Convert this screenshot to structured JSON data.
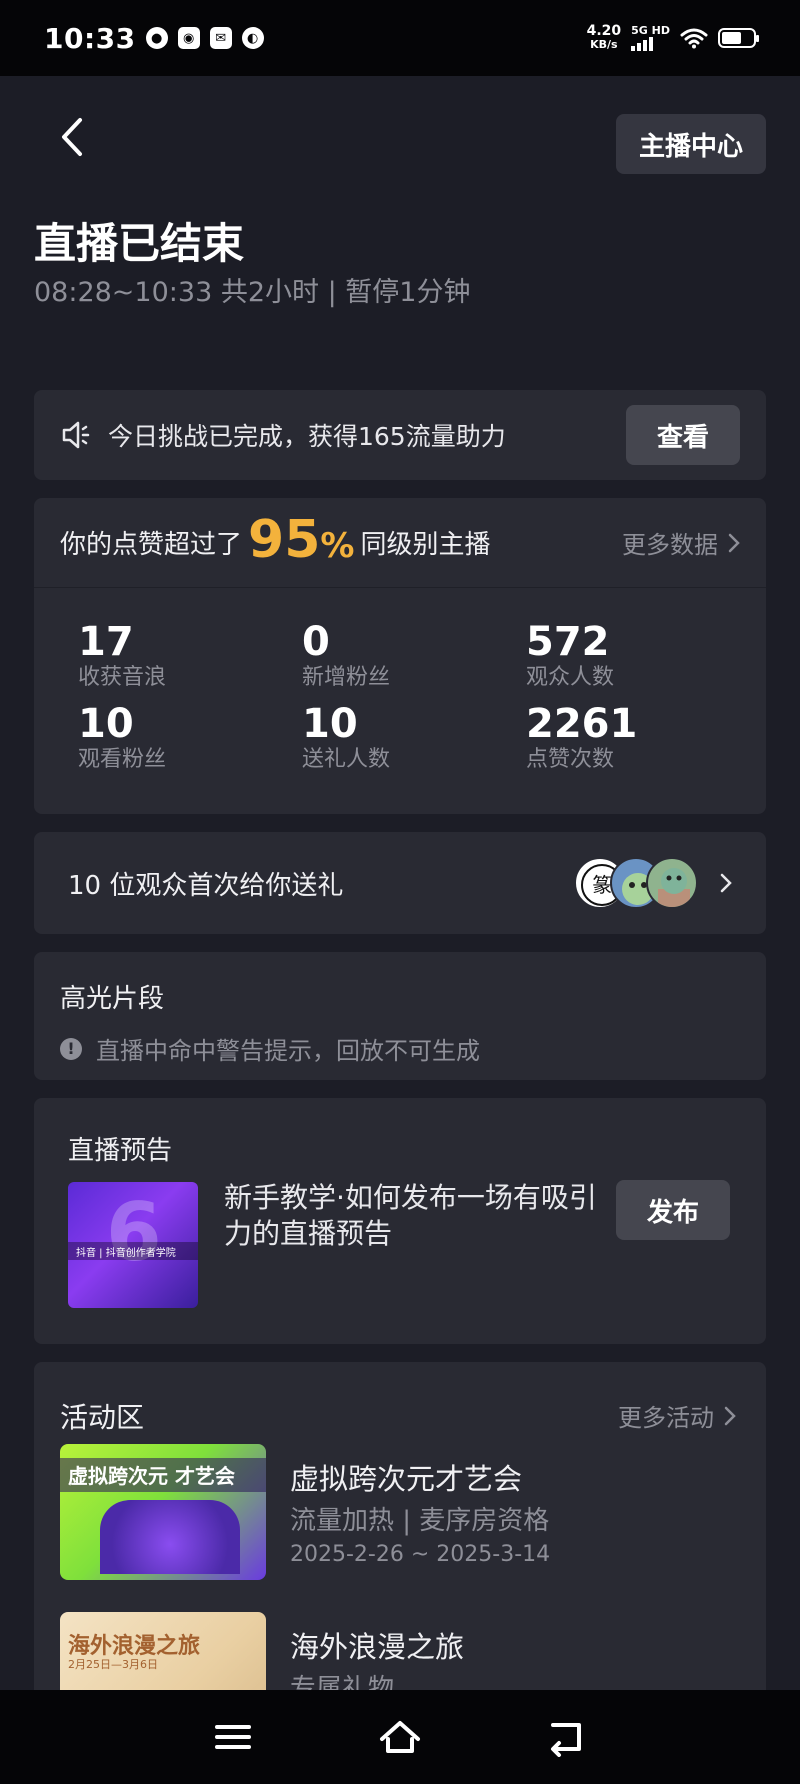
{
  "status_bar": {
    "time": "10:33",
    "speed_value": "4.20",
    "speed_unit": "KB/s",
    "network": "5G HD"
  },
  "header": {
    "anchor_center_label": "主播中心",
    "title": "直播已结束",
    "subtitle": "08:28~10:33 共2小时 | 暂停1分钟"
  },
  "challenge": {
    "text": "今日挑战已完成，获得165流量助力",
    "button_label": "查看"
  },
  "likes": {
    "prefix": "你的点赞超过了",
    "percent": "95",
    "percent_sign": "%",
    "suffix": "同级别主播",
    "more_label": "更多数据"
  },
  "stats": [
    {
      "value": "17",
      "label": "收获音浪"
    },
    {
      "value": "0",
      "label": "新增粉丝"
    },
    {
      "value": "572",
      "label": "观众人数"
    },
    {
      "value": "10",
      "label": "观看粉丝"
    },
    {
      "value": "10",
      "label": "送礼人数"
    },
    {
      "value": "2261",
      "label": "点赞次数"
    }
  ],
  "gift": {
    "text": "10 位观众首次给你送礼"
  },
  "highlight": {
    "title": "高光片段",
    "warning": "直播中命中警告提示，回放不可生成"
  },
  "preview": {
    "title": "直播预告",
    "thumb_label": "抖音 | 抖音创作者学院",
    "text": "新手教学·如何发布一场有吸引力的直播预告",
    "button_label": "发布"
  },
  "activity": {
    "title": "活动区",
    "more_label": "更多活动",
    "items": [
      {
        "thumb_text": "虚拟跨次元 才艺会",
        "name": "虚拟跨次元才艺会",
        "tags": "流量加热 | 麦序房资格",
        "date": "2025-2-26 ~ 2025-3-14"
      },
      {
        "thumb_text": "海外浪漫之旅",
        "thumb_date": "2月25日—3月6日",
        "name": "海外浪漫之旅",
        "tags": "专属礼物",
        "date": ""
      }
    ]
  },
  "colors": {
    "background": "#1c1d26",
    "card": "#292a33",
    "accent": "#f3b23c",
    "muted_text": "#8e8f98"
  }
}
